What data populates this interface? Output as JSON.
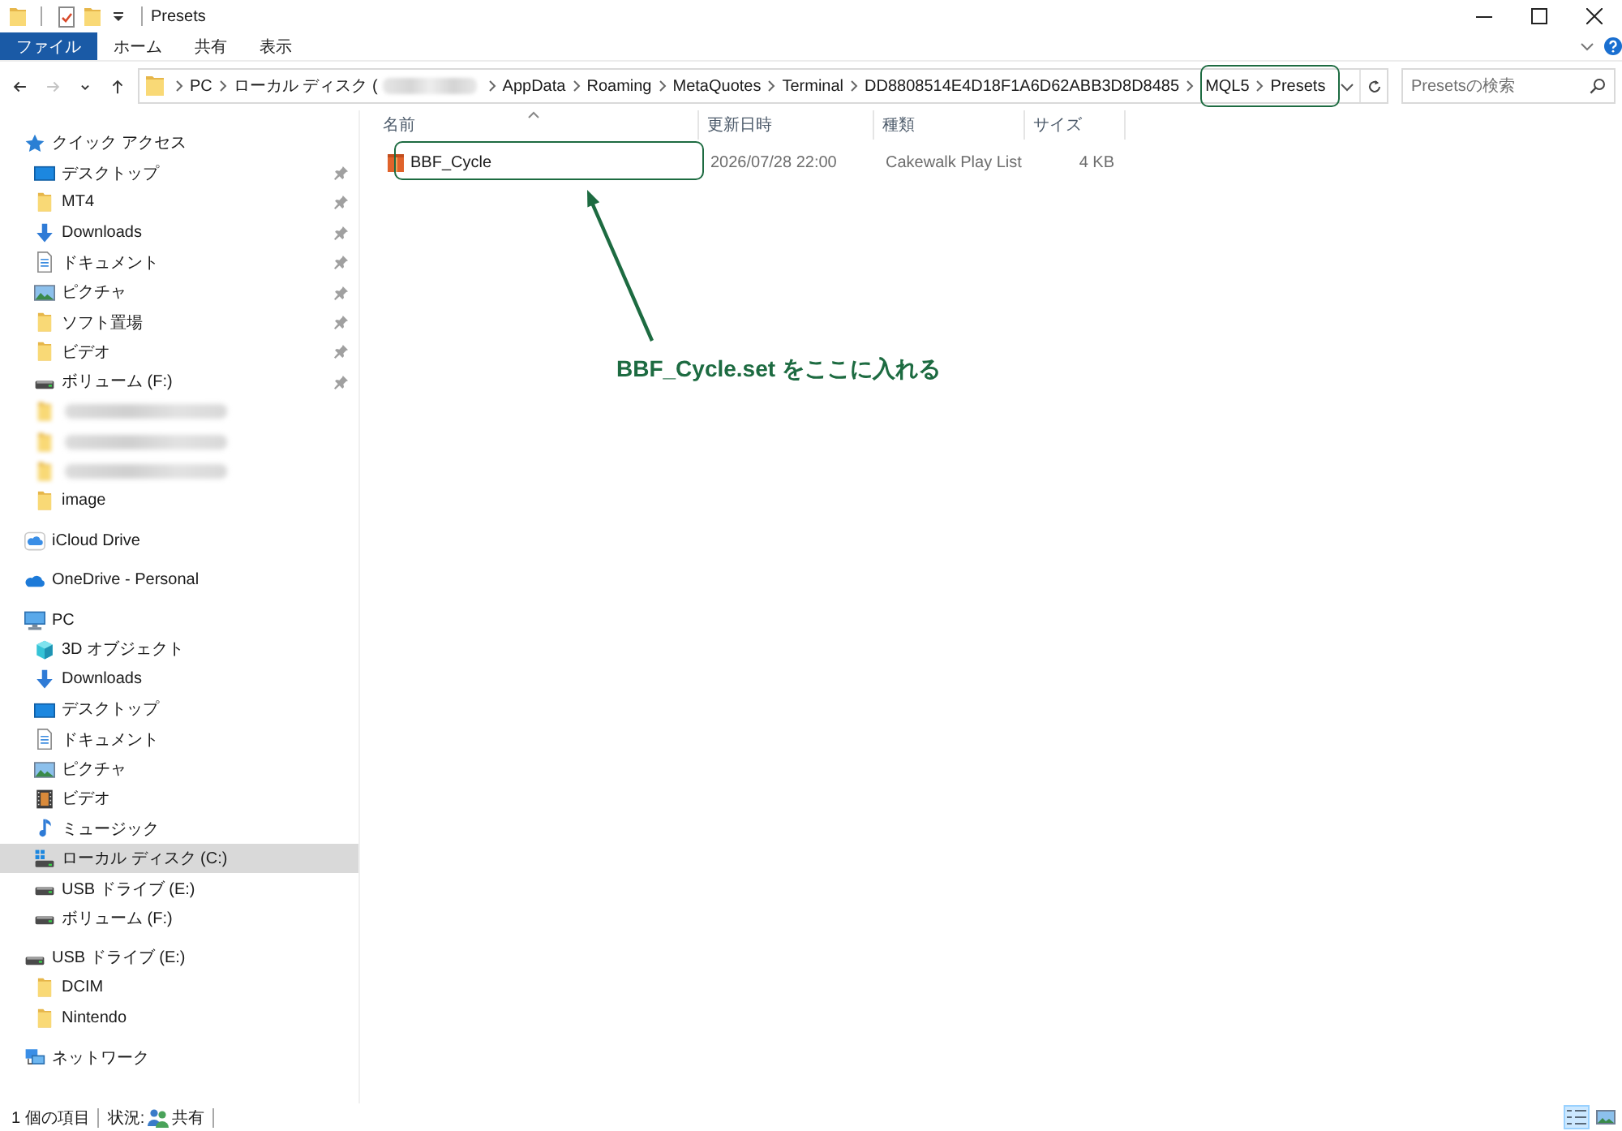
{
  "title_bar": {
    "title": "Presets"
  },
  "ribbon": {
    "tabs": [
      {
        "label": "ファイル",
        "selected": true
      },
      {
        "label": "ホーム",
        "selected": false
      },
      {
        "label": "共有",
        "selected": false
      },
      {
        "label": "表示",
        "selected": false
      }
    ]
  },
  "navigation": [
    {
      "kind": "back",
      "disabled": false
    },
    {
      "kind": "forward",
      "disabled": true
    },
    {
      "kind": "recent",
      "disabled": false
    },
    {
      "kind": "up",
      "disabled": false
    }
  ],
  "address_bar": {
    "segments": [
      {
        "kind": "text",
        "label": "PC",
        "highlighted": false
      },
      {
        "kind": "text",
        "label": "ローカル ディスク (",
        "highlighted": false
      },
      {
        "kind": "blurred",
        "highlighted": false
      },
      {
        "kind": "text",
        "label": "AppData",
        "highlighted": false
      },
      {
        "kind": "text",
        "label": "Roaming",
        "highlighted": false
      },
      {
        "kind": "text",
        "label": "MetaQuotes",
        "highlighted": false
      },
      {
        "kind": "text",
        "label": "Terminal",
        "highlighted": false
      },
      {
        "kind": "text",
        "label": "DD8808514E4D18F1A6D62ABB3D8D8485",
        "highlighted": false
      },
      {
        "kind": "text",
        "label": "MQL5",
        "highlighted": true
      },
      {
        "kind": "text",
        "label": "Presets",
        "highlighted": true
      }
    ]
  },
  "search": {
    "placeholder": "Presetsの検索"
  },
  "sidebar": {
    "items": [
      {
        "kind": "quick_access",
        "label": "クイック アクセス",
        "selected": false,
        "children": [
          {
            "kind": "desktop",
            "label": "デスクトップ",
            "pinned": true,
            "selected": false
          },
          {
            "kind": "folder",
            "label": "MT4",
            "pinned": true,
            "selected": false
          },
          {
            "kind": "downloads",
            "label": "Downloads",
            "pinned": true,
            "selected": false
          },
          {
            "kind": "documents",
            "label": "ドキュメント",
            "pinned": true,
            "selected": false
          },
          {
            "kind": "pictures",
            "label": "ピクチャ",
            "pinned": true,
            "selected": false
          },
          {
            "kind": "folder",
            "label": "ソフト置場",
            "pinned": true,
            "selected": false
          },
          {
            "kind": "folder",
            "label": "ビデオ",
            "pinned": true,
            "selected": false
          },
          {
            "kind": "drive",
            "label": "ボリューム (F:)",
            "pinned": true,
            "selected": false
          },
          {
            "kind": "blurred",
            "pinned": false,
            "selected": false
          },
          {
            "kind": "blurred",
            "pinned": false,
            "selected": false
          },
          {
            "kind": "blurred",
            "pinned": false,
            "selected": false
          },
          {
            "kind": "folder",
            "label": "image",
            "pinned": false,
            "selected": false
          }
        ]
      },
      {
        "kind": "icloud",
        "label": "iCloud Drive",
        "selected": false
      },
      {
        "kind": "onedrive",
        "label": "OneDrive - Personal",
        "selected": false
      },
      {
        "kind": "pc",
        "label": "PC",
        "selected": false,
        "children": [
          {
            "kind": "objects_3d",
            "label": "3D オブジェクト",
            "selected": false
          },
          {
            "kind": "downloads",
            "label": "Downloads",
            "selected": false
          },
          {
            "kind": "desktop",
            "label": "デスクトップ",
            "selected": false
          },
          {
            "kind": "documents",
            "label": "ドキュメント",
            "selected": false
          },
          {
            "kind": "pictures",
            "label": "ピクチャ",
            "selected": false
          },
          {
            "kind": "videos",
            "label": "ビデオ",
            "selected": false
          },
          {
            "kind": "music",
            "label": "ミュージック",
            "selected": false
          },
          {
            "kind": "system_drive",
            "label": "ローカル ディスク (C:)",
            "selected": true
          },
          {
            "kind": "drive",
            "label": "USB ドライブ (E:)",
            "selected": false
          },
          {
            "kind": "drive",
            "label": "ボリューム (F:)",
            "selected": false
          }
        ]
      },
      {
        "kind": "drive",
        "label": "USB ドライブ (E:)",
        "selected": false,
        "children": [
          {
            "kind": "folder",
            "label": "DCIM",
            "selected": false
          },
          {
            "kind": "folder",
            "label": "Nintendo",
            "selected": false
          }
        ]
      },
      {
        "kind": "network",
        "label": "ネットワーク",
        "selected": false
      }
    ]
  },
  "file_list": {
    "columns": [
      {
        "label": "名前",
        "sorted": true
      },
      {
        "label": "更新日時",
        "sorted": false
      },
      {
        "label": "種類",
        "sorted": false
      },
      {
        "label": "サイズ",
        "sorted": false
      }
    ],
    "rows": [
      {
        "name": "BBF_Cycle",
        "modified": "2026/07/28 22:00",
        "type": "Cakewalk Play List",
        "size": "4 KB",
        "highlighted": true,
        "selected": false
      }
    ]
  },
  "callout": {
    "text": "BBF_Cycle.set をここに入れる"
  },
  "status_bar": {
    "item_count": "1 個の項目",
    "status_label": "状況:",
    "status_value": "共有",
    "views": [
      {
        "kind": "details",
        "selected": true
      },
      {
        "kind": "large_icons",
        "selected": false
      }
    ]
  }
}
